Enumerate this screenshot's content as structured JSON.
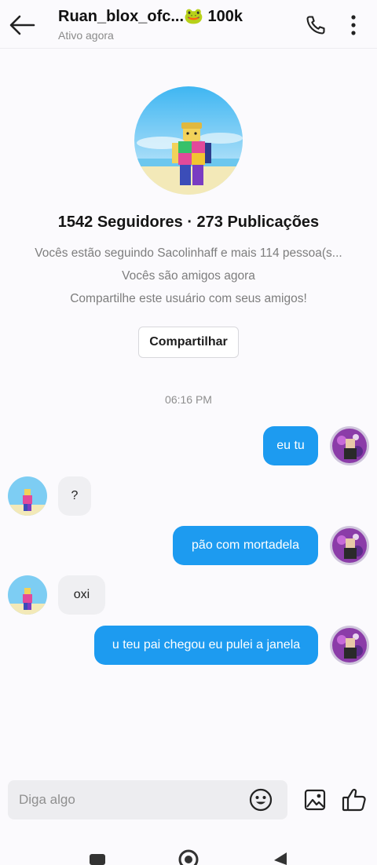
{
  "header": {
    "back_icon": "arrow-left-icon",
    "title": "Ruan_blox_ofc...🐸 100k",
    "status": "Ativo agora",
    "call_icon": "phone-icon",
    "more_icon": "more-vertical-icon"
  },
  "profile": {
    "stats": "1542 Seguidores · 273 Publicações",
    "mutual": "Vocês estão seguindo Sacolinhaff e mais 114 pessoa(s...",
    "friends": "Vocês são amigos agora",
    "share_prompt": "Compartilhe este usuário com seus amigos!",
    "share_button": "Compartilhar"
  },
  "timestamp": "06:16 PM",
  "messages": [
    {
      "side": "out",
      "text": "eu tu"
    },
    {
      "side": "in",
      "text": "?"
    },
    {
      "side": "out",
      "text": "pão com mortadela"
    },
    {
      "side": "in",
      "text": "oxi"
    },
    {
      "side": "out",
      "text": "u teu pai chegou eu pulei a janela"
    }
  ],
  "composer": {
    "placeholder": "Diga algo",
    "emoji_icon": "smiley-icon",
    "image_icon": "image-icon",
    "like_icon": "thumbs-up-icon"
  },
  "colors": {
    "outgoing_bubble": "#1d9bf0",
    "incoming_bubble": "#efeff2",
    "background": "#fbfafd"
  },
  "system_nav": [
    "square-icon",
    "circle-icon",
    "triangle-back-icon"
  ]
}
